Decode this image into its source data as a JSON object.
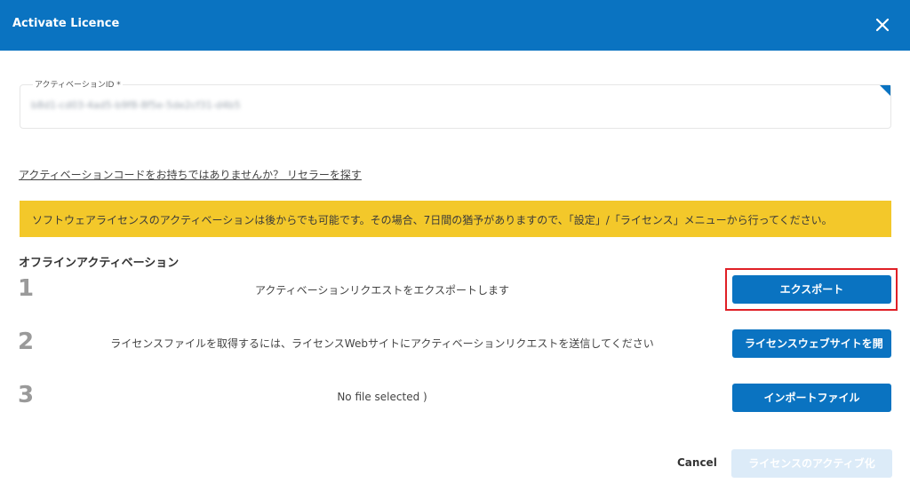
{
  "dialog": {
    "title": "Activate Licence",
    "close_icon": "close-icon"
  },
  "activation_id": {
    "label": "アクティベーションID *",
    "value": "b8d1-cd03-4ad5-b9f8-8f5e-5de2cf31-d4b5"
  },
  "reseller_link": "アクティベーションコードをお持ちではありませんか？ リセラーを探す",
  "banner": {
    "text": "ソフトウェアライセンスのアクティベーションは後からでも可能です。その場合、7日間の猶予がありますので、「設定」/「ライセンス」メニューから行ってください。",
    "color": "#f3c82a"
  },
  "offline": {
    "title": "オフラインアクティベーション",
    "steps": [
      {
        "number": "1",
        "text": "アクティベーションリクエストをエクスポートします",
        "button": "エクスポート"
      },
      {
        "number": "2",
        "text": "ライセンスファイルを取得するには、ライセンスWebサイトにアクティベーションリクエストを送信してください",
        "button": "ライセンスウェブサイトを開"
      },
      {
        "number": "3",
        "text": "No file selected )",
        "button": "インポートファイル"
      }
    ]
  },
  "footer": {
    "cancel": "Cancel",
    "activate": "ライセンスのアクティブ化"
  },
  "colors": {
    "primary": "#0a73c1",
    "highlight": "#e01f26",
    "disabled": "#dcebf8"
  }
}
